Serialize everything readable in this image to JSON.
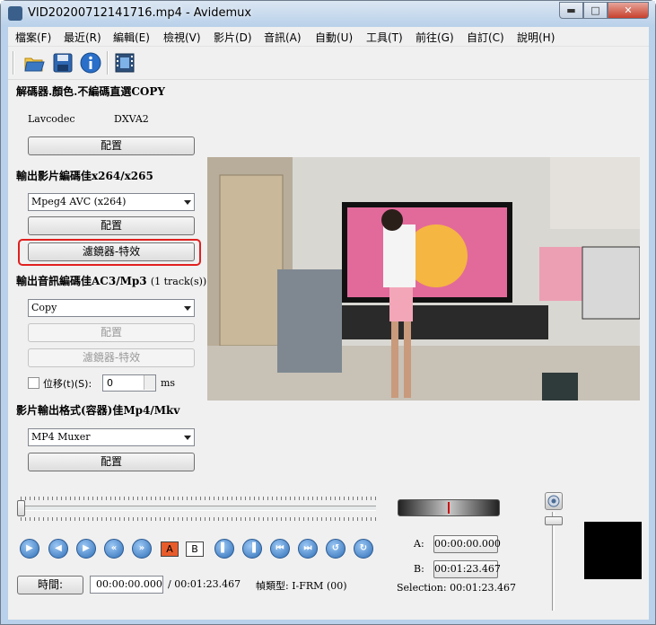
{
  "window": {
    "title": "VID20200712141716.mp4 - Avidemux",
    "min": "▬",
    "max": "□",
    "close": "✕"
  },
  "menu": [
    "檔案(F)",
    "最近(R)",
    "編輯(E)",
    "檢視(V)",
    "影片(D)",
    "音訊(A)",
    "自動(U)",
    "工具(T)",
    "前往(G)",
    "自訂(C)",
    "說明(H)"
  ],
  "toolbar": {
    "icons": [
      "open-folder-icon",
      "save-icon",
      "info-icon",
      "filmstrip-icon"
    ]
  },
  "decoder": {
    "header": "解碼器.顏色.不編碼直選COPY",
    "codec_name": "Lavcodec",
    "codec_hw": "DXVA2",
    "config_label": "配置"
  },
  "video_output": {
    "header": "輸出影片編碼佳x264/x265",
    "selected": "Mpeg4 AVC (x264)",
    "config_label": "配置",
    "filters_label": "濾鏡器-特效"
  },
  "audio_output": {
    "header": "輸出音訊編碼佳AC3/Mp3",
    "tracks": "(1 track(s))",
    "selected": "Copy",
    "config_label": "配置",
    "filters_label": "濾鏡器-特效",
    "shift_label": "位移(t)(S):",
    "shift_value": "0",
    "shift_unit": "ms"
  },
  "container": {
    "header": "影片輸出格式(容器)佳Mp4/Mkv",
    "selected": "MP4 Muxer",
    "config_label": "配置"
  },
  "playback": {
    "a_mark": "A",
    "b_mark": "B",
    "time_button": "時間:",
    "current_time": "00:00:00.000",
    "total_time": "/ 00:01:23.467",
    "frame_type": "幀類型:  I-FRM (00)"
  },
  "selection": {
    "a_label": "A:",
    "a_value": "00:00:00.000",
    "b_label": "B:",
    "b_value": "00:01:23.467",
    "selection_text": "Selection: 00:01:23.467"
  },
  "colors": {
    "highlight": "#e0201f",
    "accent": "#2f6fb7"
  }
}
